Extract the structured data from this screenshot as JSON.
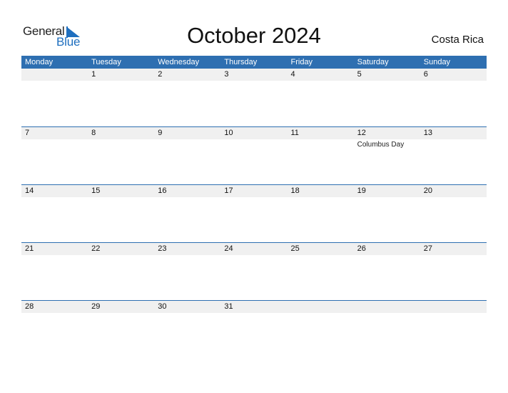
{
  "logo": {
    "general": "General",
    "blue": "Blue"
  },
  "title": "October 2024",
  "country": "Costa Rica",
  "weekdays": [
    "Monday",
    "Tuesday",
    "Wednesday",
    "Thursday",
    "Friday",
    "Saturday",
    "Sunday"
  ],
  "weeks": [
    {
      "days": [
        "",
        "1",
        "2",
        "3",
        "4",
        "5",
        "6"
      ],
      "holidays": [
        "",
        "",
        "",
        "",
        "",
        "",
        ""
      ]
    },
    {
      "days": [
        "7",
        "8",
        "9",
        "10",
        "11",
        "12",
        "13"
      ],
      "holidays": [
        "",
        "",
        "",
        "",
        "",
        "Columbus Day",
        ""
      ]
    },
    {
      "days": [
        "14",
        "15",
        "16",
        "17",
        "18",
        "19",
        "20"
      ],
      "holidays": [
        "",
        "",
        "",
        "",
        "",
        "",
        ""
      ]
    },
    {
      "days": [
        "21",
        "22",
        "23",
        "24",
        "25",
        "26",
        "27"
      ],
      "holidays": [
        "",
        "",
        "",
        "",
        "",
        "",
        ""
      ]
    },
    {
      "days": [
        "28",
        "29",
        "30",
        "31",
        "",
        "",
        ""
      ],
      "holidays": [
        "",
        "",
        "",
        "",
        "",
        "",
        ""
      ]
    }
  ],
  "colors": {
    "accent": "#2e6fb1",
    "band": "#f0f0f0",
    "logo_blue": "#1f6fbf"
  }
}
